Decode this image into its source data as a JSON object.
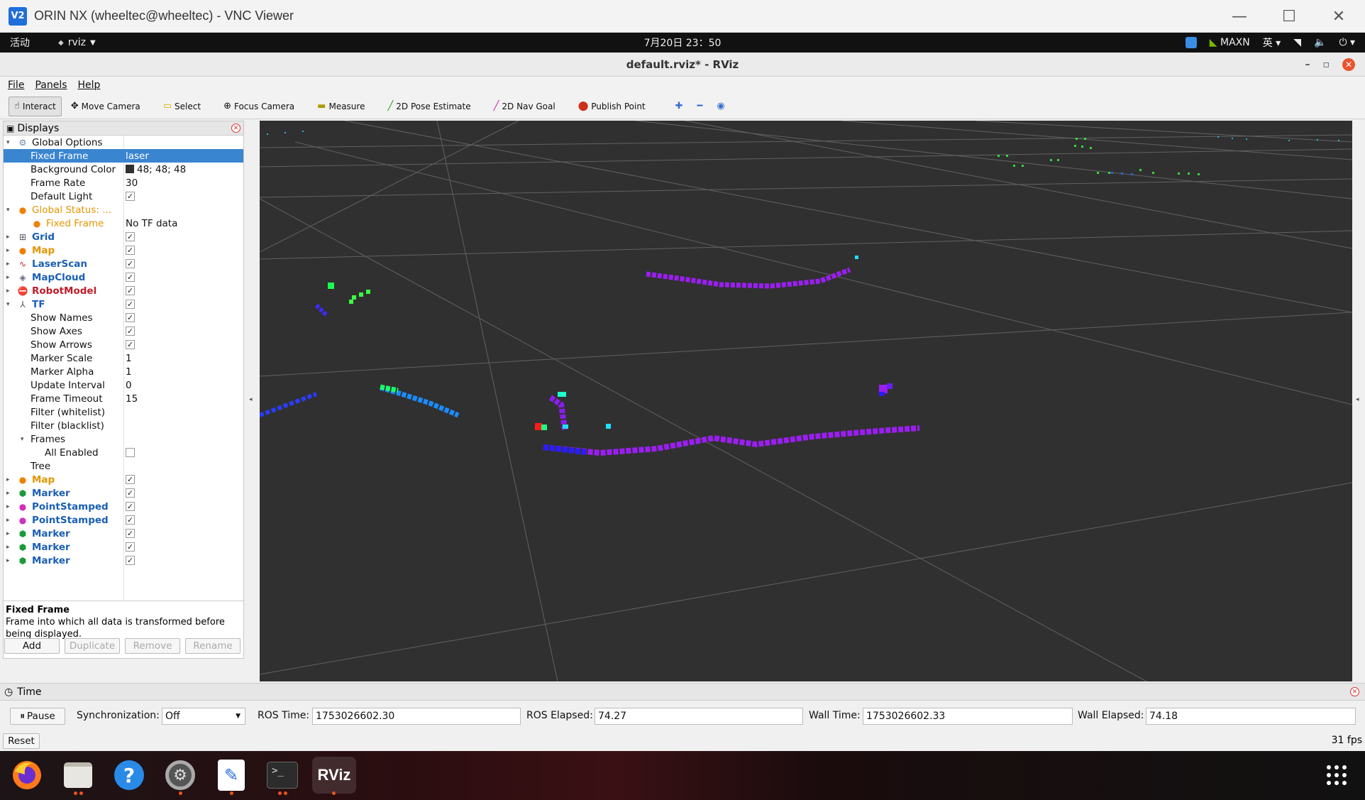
{
  "vnc": {
    "title": "ORIN NX (wheeltec@wheeltec) - VNC Viewer",
    "logo": "V2",
    "minimize": "—",
    "maximize": "☐",
    "close": "✕"
  },
  "topbar": {
    "activities": "活动",
    "app_name": "rviz",
    "clock": "7月20日  23：50",
    "power_mode": "MAXN",
    "input_method": "英"
  },
  "rviz": {
    "window_title": "default.rviz* - RViz"
  },
  "menu": {
    "file": "File",
    "panels": "Panels",
    "help": "Help"
  },
  "toolbar": {
    "interact": "Interact",
    "move_camera": "Move Camera",
    "select": "Select",
    "focus_camera": "Focus Camera",
    "measure": "Measure",
    "pose_estimate": "2D Pose Estimate",
    "nav_goal": "2D Nav Goal",
    "publish_point": "Publish Point"
  },
  "displays": {
    "title": "Displays",
    "rows": [
      {
        "label": "Global Options",
        "value": "",
        "check": ""
      },
      {
        "label": "Fixed Frame",
        "value": "laser"
      },
      {
        "label": "Background Color",
        "value": "48; 48; 48"
      },
      {
        "label": "Frame Rate",
        "value": "30"
      },
      {
        "label": "Default Light",
        "value": ""
      },
      {
        "label": "Global Status: ...",
        "value": ""
      },
      {
        "label": "Fixed Frame",
        "value": "No TF data"
      },
      {
        "label": "Grid",
        "value": ""
      },
      {
        "label": "Map",
        "value": ""
      },
      {
        "label": "LaserScan",
        "value": ""
      },
      {
        "label": "MapCloud",
        "value": ""
      },
      {
        "label": "RobotModel",
        "value": ""
      },
      {
        "label": "TF",
        "value": ""
      },
      {
        "label": "Show Names",
        "value": ""
      },
      {
        "label": "Show Axes",
        "value": ""
      },
      {
        "label": "Show Arrows",
        "value": ""
      },
      {
        "label": "Marker Scale",
        "value": "1"
      },
      {
        "label": "Marker Alpha",
        "value": "1"
      },
      {
        "label": "Update Interval",
        "value": "0"
      },
      {
        "label": "Frame Timeout",
        "value": "15"
      },
      {
        "label": "Filter (whitelist)",
        "value": ""
      },
      {
        "label": "Filter (blacklist)",
        "value": ""
      },
      {
        "label": "Frames",
        "value": ""
      },
      {
        "label": "All Enabled",
        "value": ""
      },
      {
        "label": "Tree",
        "value": ""
      },
      {
        "label": "Map",
        "value": ""
      },
      {
        "label": "Marker",
        "value": ""
      },
      {
        "label": "PointStamped",
        "value": ""
      },
      {
        "label": "PointStamped",
        "value": ""
      },
      {
        "label": "Marker",
        "value": ""
      },
      {
        "label": "Marker",
        "value": ""
      },
      {
        "label": "Marker",
        "value": ""
      }
    ],
    "description_title": "Fixed Frame",
    "description_text": "Frame into which all data is transformed before being displayed.",
    "buttons": {
      "add": "Add",
      "duplicate": "Duplicate",
      "remove": "Remove",
      "rename": "Rename"
    }
  },
  "time_panel": {
    "title": "Time",
    "pause": "Pause",
    "sync_label": "Synchronization:",
    "sync_value": "Off",
    "ros_time_label": "ROS Time:",
    "ros_time": "1753026602.30",
    "ros_elapsed_label": "ROS Elapsed:",
    "ros_elapsed": "74.27",
    "wall_time_label": "Wall Time:",
    "wall_time": "1753026602.33",
    "wall_elapsed_label": "Wall Elapsed:",
    "wall_elapsed": "74.18",
    "reset": "Reset",
    "fps": "31 fps"
  },
  "dock": {
    "rviz_label": "RViz",
    "terminal_label": ">_",
    "help_label": "?"
  },
  "colors": {
    "background": "#303030",
    "selection": "#3a85d0",
    "accent_orange": "#e95420"
  }
}
